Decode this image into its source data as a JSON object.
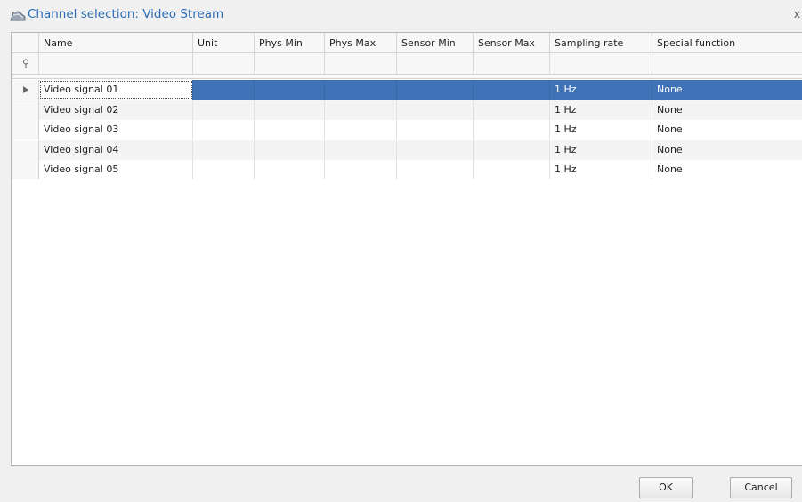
{
  "window": {
    "title": "Channel selection: Video Stream",
    "close_glyph": "x"
  },
  "grid": {
    "columns": [
      "Name",
      "Unit",
      "Phys Min",
      "Phys Max",
      "Sensor Min",
      "Sensor Max",
      "Sampling rate",
      "Special function"
    ],
    "filter_icon": "filter-pin-icon",
    "row_indicator_icon": "triangle-right-icon",
    "selected_row_index": 0,
    "rows": [
      {
        "name": "Video signal 01",
        "unit": "",
        "phys_min": "",
        "phys_max": "",
        "sensor_min": "",
        "sensor_max": "",
        "sampling_rate": "1 Hz",
        "special_function": "None"
      },
      {
        "name": "Video signal 02",
        "unit": "",
        "phys_min": "",
        "phys_max": "",
        "sensor_min": "",
        "sensor_max": "",
        "sampling_rate": "1 Hz",
        "special_function": "None"
      },
      {
        "name": "Video signal 03",
        "unit": "",
        "phys_min": "",
        "phys_max": "",
        "sensor_min": "",
        "sensor_max": "",
        "sampling_rate": "1 Hz",
        "special_function": "None"
      },
      {
        "name": "Video signal 04",
        "unit": "",
        "phys_min": "",
        "phys_max": "",
        "sensor_min": "",
        "sensor_max": "",
        "sampling_rate": "1 Hz",
        "special_function": "None"
      },
      {
        "name": "Video signal 05",
        "unit": "",
        "phys_min": "",
        "phys_max": "",
        "sensor_min": "",
        "sensor_max": "",
        "sampling_rate": "1 Hz",
        "special_function": "None"
      }
    ]
  },
  "buttons": {
    "ok_label": "OK",
    "cancel_label": "Cancel"
  },
  "colors": {
    "title": "#2d6db5",
    "selection": "#3f72b7"
  }
}
